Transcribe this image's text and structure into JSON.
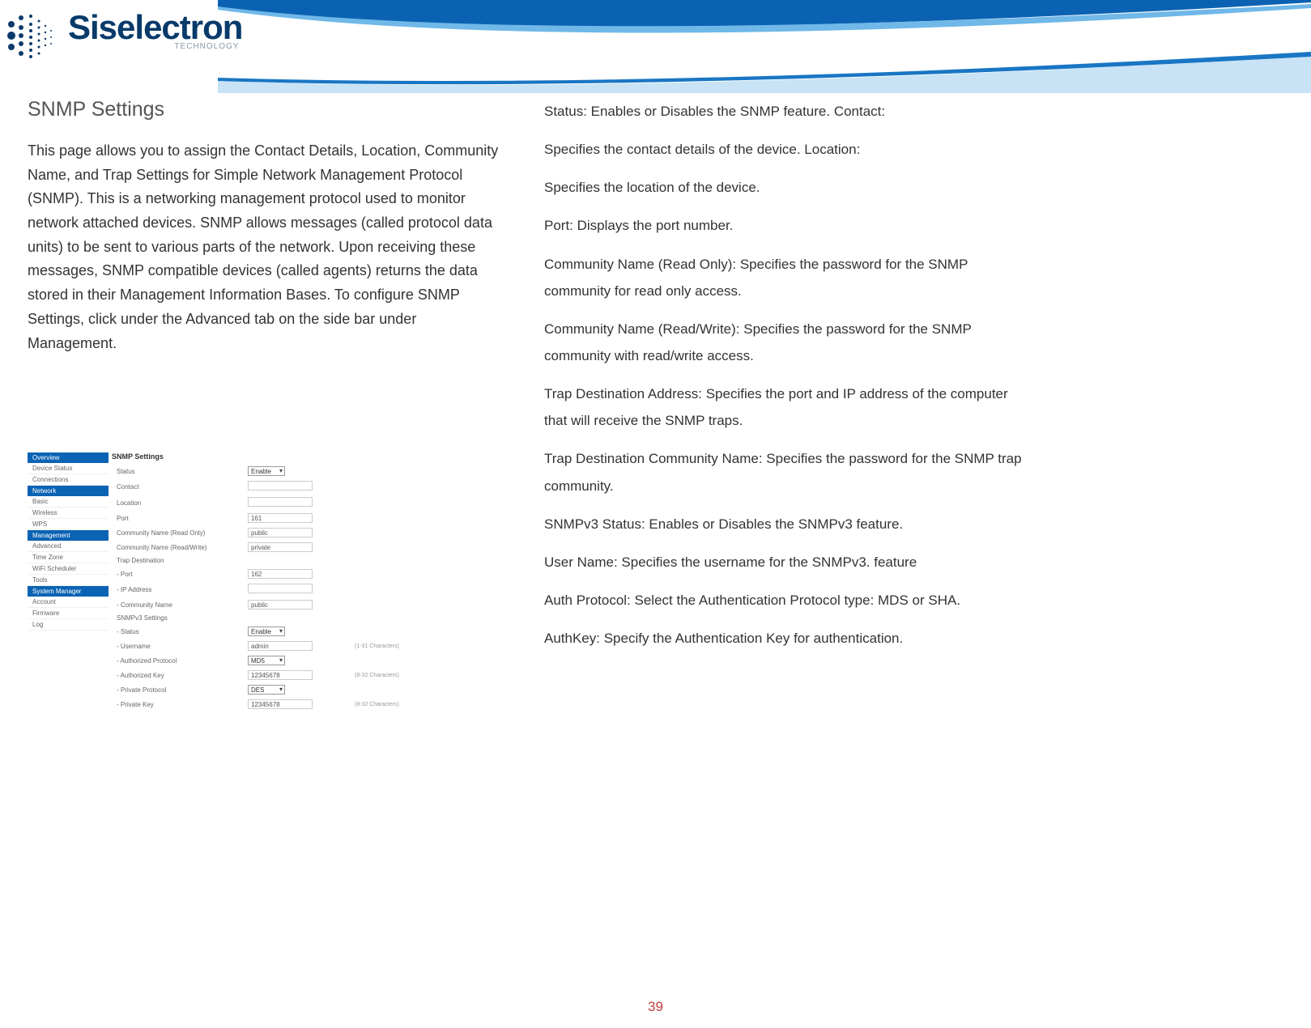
{
  "brand": {
    "name": "Siselectron",
    "sub": "TECHNOLOGY"
  },
  "title": "SNMP Settings",
  "intro": "This page  allows  you  to  assign   the  Contact   Details,  Location, Community  Name, and Trap Settings for Simple Network Management Protocol (SNMP). This  is a networking management protocol used to monitor      network  attached  devices. SNMP  allows messages (called protocol data  units) to be sent to various parts of the network.  Upon receiving   these  messages,  SNMP compatible devices (called  agents) returns the data stored in their   Management Information Bases. To configure SNMP Settings, click under the Advanced tab on the side bar under Management.",
  "desc": {
    "p1": "Status: Enables  or Disables  the  SNMP feature. Contact:",
    "p2": "Specifies  the  contact details of the  device. Location:",
    "p3": "Specifies  the  location  of the  device.",
    "p4": "Port: Displays  the  port  number.",
    "p5": "Community Name  (Read  Only):  Specifies  the  password for the SNMP community  for read  only access.",
    "p6": "Community Name  (Read/Write):  Specifies  the  password for the SNMP community  with  read/write access.",
    "p7": "Trap   Destination   Address:  Specifies   the   port   and   IP address of the  computer that  will receive the  SNMP traps.",
    "p8": "Trap    Destination    Community  Name:    Specifies    the password   for the  SNMP trap  community.",
    "p9": "SNMPv3  Status:  Enables  or Disables  the  SNMPv3 feature.",
    "p10": "User    Name:    Specifies    the   username  for    the   SNMPv3. feature",
    "p11": "Auth   Protocol:  Select   the  Authentication  Protocol  type: MDS or SHA.",
    "p12": "AuthKey:  Specify the  Authentication  Key  for  authentication."
  },
  "sidebar": {
    "sections": {
      "overview": {
        "title": "Overview",
        "items": [
          "Device Status",
          "Connections"
        ]
      },
      "network": {
        "title": "Network",
        "items": [
          "Basic",
          "Wireless",
          "WPS"
        ]
      },
      "management": {
        "title": "Management",
        "items": [
          "Advanced",
          "Time Zone",
          "WiFi Scheduler",
          "Tools"
        ]
      },
      "system": {
        "title": "System Manager",
        "items": [
          "Account",
          "Firmware",
          "Log"
        ]
      }
    }
  },
  "panel": {
    "title": "SNMP Settings",
    "rows": {
      "status": {
        "label": "Status",
        "value": "Enable"
      },
      "contact": {
        "label": "Contact",
        "value": ""
      },
      "location": {
        "label": "Location",
        "value": ""
      },
      "port": {
        "label": "Port",
        "value": "161"
      },
      "cnro": {
        "label": "Community Name (Read Only)",
        "value": "public"
      },
      "cnrw": {
        "label": "Community Name (Read/Write)",
        "value": "private"
      },
      "trapdest": {
        "label": "Trap Destination"
      },
      "trapport": {
        "label": "- Port",
        "value": "162"
      },
      "trapip": {
        "label": "- IP Address",
        "value": ""
      },
      "trapcn": {
        "label": "- Community Name",
        "value": "public"
      },
      "v3sett": {
        "label": "SNMPv3 Settings"
      },
      "v3status": {
        "label": "- Status",
        "value": "Enable"
      },
      "v3user": {
        "label": "- Username",
        "value": "admin",
        "hint": "(1-31 Characters)"
      },
      "v3authp": {
        "label": "- Authorized Protocol",
        "value": "MD5"
      },
      "v3authk": {
        "label": "- Authorized Key",
        "value": "12345678",
        "hint": "(8-32 Characters)"
      },
      "v3privp": {
        "label": "- Private Protocol",
        "value": "DES"
      },
      "v3privk": {
        "label": "- Private Key",
        "value": "12345678",
        "hint": "(8-32 Characters)"
      }
    }
  },
  "pageNumber": "39"
}
